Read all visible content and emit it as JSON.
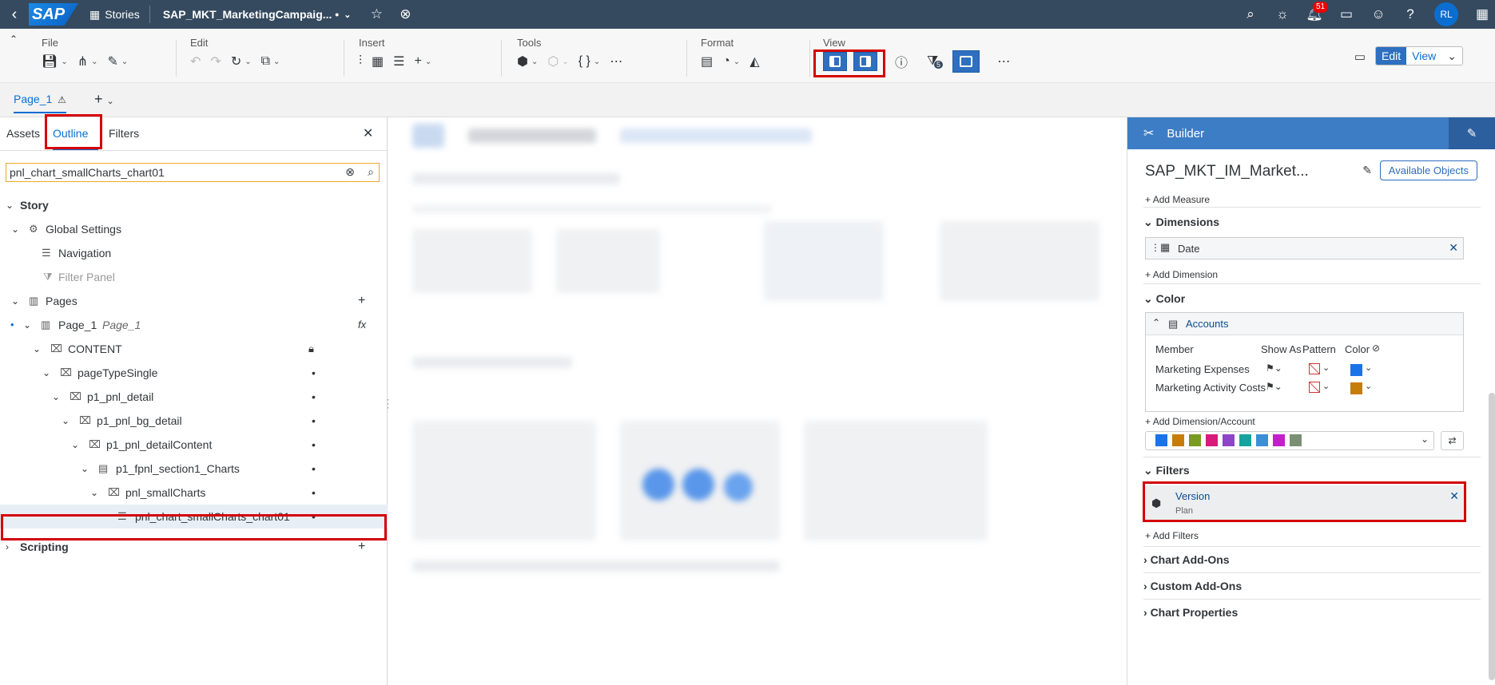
{
  "shell": {
    "logo": "SAP",
    "stories_label": "Stories",
    "doc_title": "SAP_MKT_MarketingCampaig... •",
    "notification_count": "51",
    "user_initials": "RL"
  },
  "toolbar": {
    "groups": {
      "file": "File",
      "edit": "Edit",
      "insert": "Insert",
      "tools": "Tools",
      "format": "Format",
      "view": "View"
    },
    "filter_count": "5",
    "edit_label": "Edit",
    "view_label": "View"
  },
  "page_tab": "Page_1",
  "left_panel": {
    "tabs": [
      "Assets",
      "Outline",
      "Filters"
    ],
    "search_value": "pnl_chart_smallCharts_chart01",
    "tree": [
      {
        "label": "Story",
        "italic": ""
      },
      {
        "label": "Global Settings",
        "italic": ""
      },
      {
        "label": "Navigation",
        "italic": ""
      },
      {
        "label": "Filter Panel",
        "italic": ""
      },
      {
        "label": "Pages",
        "italic": ""
      },
      {
        "label": "Page_1",
        "italic": "Page_1"
      },
      {
        "label": "CONTENT",
        "italic": ""
      },
      {
        "label": "pageTypeSingle",
        "italic": ""
      },
      {
        "label": "p1_pnl_detail",
        "italic": ""
      },
      {
        "label": "p1_pnl_bg_detail",
        "italic": ""
      },
      {
        "label": "p1_pnl_detailContent",
        "italic": ""
      },
      {
        "label": "p1_fpnl_section1_Charts",
        "italic": ""
      },
      {
        "label": "pnl_smallCharts",
        "italic": ""
      },
      {
        "label": "pnl_chart_smallCharts_chart01",
        "italic": ""
      },
      {
        "label": "Scripting",
        "italic": ""
      }
    ]
  },
  "builder": {
    "header": "Builder",
    "model": "SAP_MKT_IM_Market...",
    "available_objects": "Available Objects",
    "add_measure": "Add Measure",
    "dimensions_title": "Dimensions",
    "date_dim": "Date",
    "add_dimension": "Add Dimension",
    "color_title": "Color",
    "accounts_label": "Accounts",
    "color_headers": {
      "member": "Member",
      "show_as": "Show As",
      "pattern": "Pattern",
      "color": "Color"
    },
    "members": [
      {
        "name": "Marketing Expenses",
        "color": "#1a73e8"
      },
      {
        "name": "Marketing Activity Costs",
        "color": "#c87c0a"
      }
    ],
    "add_dimension_account": "Add Dimension/Account",
    "palette": [
      "#1a73e8",
      "#c87c0a",
      "#7a9a22",
      "#d81b7a",
      "#8e44c9",
      "#14a39e",
      "#3a8fd6",
      "#c020c8",
      "#7b8f74"
    ],
    "filters_title": "Filters",
    "filter_name": "Version",
    "filter_value": "Plan",
    "add_filters": "Add Filters",
    "chart_addons": "Chart Add-Ons",
    "custom_addons": "Custom Add-Ons",
    "chart_properties": "Chart Properties"
  }
}
